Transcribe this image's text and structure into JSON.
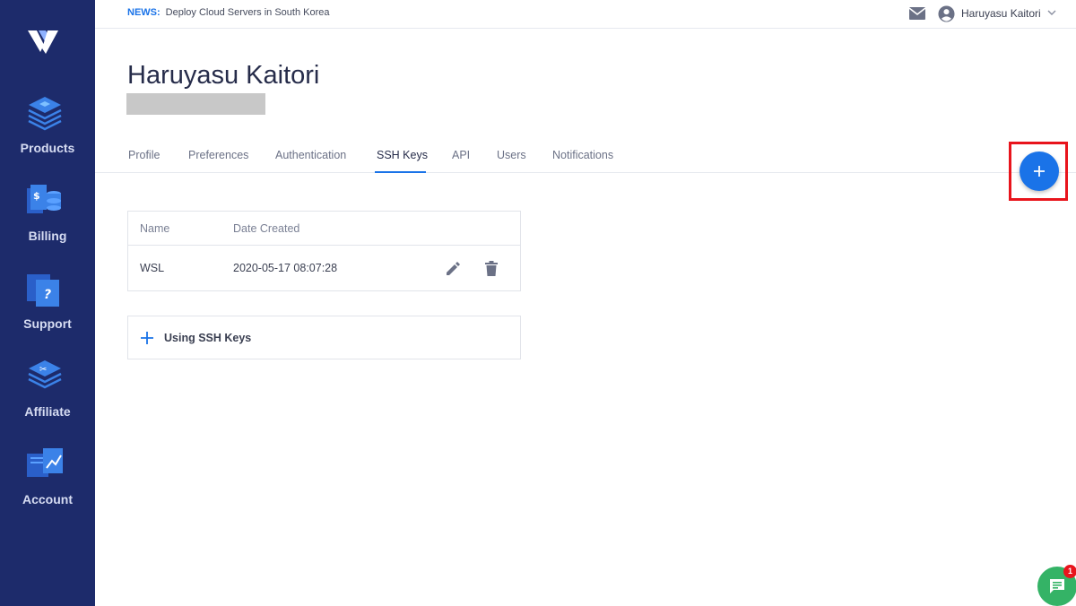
{
  "news": {
    "tag": "NEWS:",
    "text": "Deploy Cloud Servers in South Korea"
  },
  "user": {
    "name": "Haruyasu Kaitori"
  },
  "sidebar": {
    "items": [
      {
        "label": "Products",
        "icon": "products-icon"
      },
      {
        "label": "Billing",
        "icon": "billing-icon"
      },
      {
        "label": "Support",
        "icon": "support-icon"
      },
      {
        "label": "Affiliate",
        "icon": "affiliate-icon"
      },
      {
        "label": "Account",
        "icon": "account-icon"
      }
    ]
  },
  "page": {
    "title": "Haruyasu Kaitori"
  },
  "tabs": [
    {
      "label": "Profile"
    },
    {
      "label": "Preferences"
    },
    {
      "label": "Authentication"
    },
    {
      "label": "SSH Keys",
      "active": true
    },
    {
      "label": "API"
    },
    {
      "label": "Users"
    },
    {
      "label": "Notifications"
    }
  ],
  "table": {
    "headers": {
      "name": "Name",
      "date": "Date Created"
    },
    "rows": [
      {
        "name": "WSL",
        "date": "2020-05-17 08:07:28"
      }
    ]
  },
  "accordion": {
    "label": "Using SSH Keys"
  },
  "chat": {
    "badge": "1"
  },
  "colors": {
    "sidebar": "#1d2b6b",
    "accent": "#1a73e8",
    "highlight": "#e8141c",
    "chat": "#34b366"
  }
}
